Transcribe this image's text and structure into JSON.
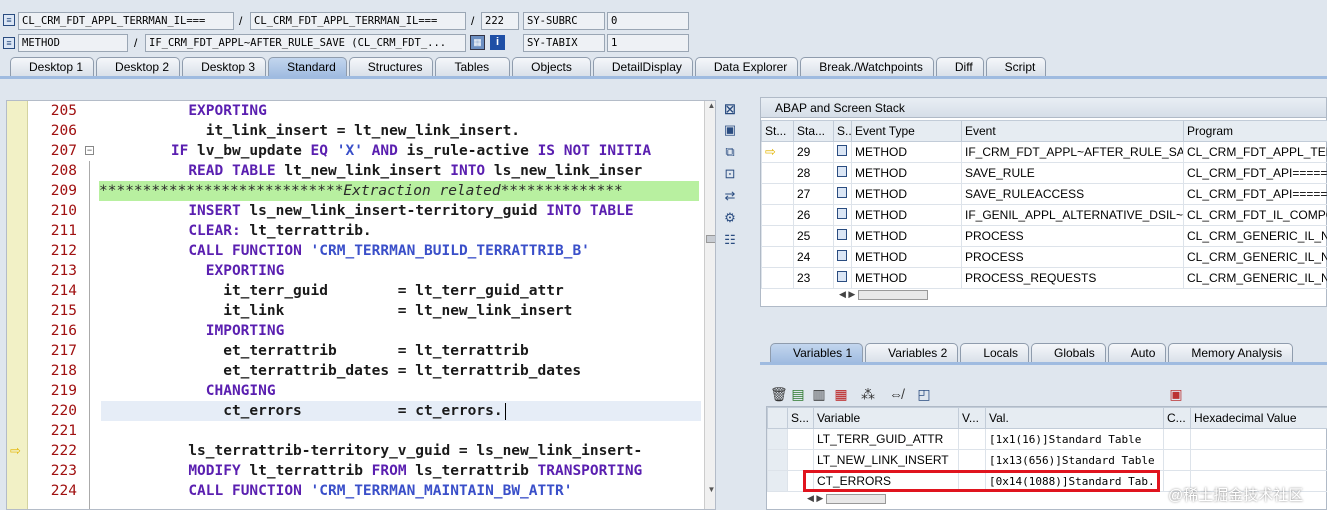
{
  "header": {
    "class_field1": "CL_CRM_FDT_APPL_TERRMAN_IL===",
    "sep1": "/",
    "class_field2": "CL_CRM_FDT_APPL_TERRMAN_IL===",
    "sep2": "/",
    "line_no": "222",
    "subrc_label": "SY-SUBRC",
    "subrc_value": "0",
    "type_field": "METHOD",
    "sep3": "/",
    "method_field": "IF_CRM_FDT_APPL~AFTER_RULE_SAVE (CL_CRM_FDT_...",
    "tabix_label": "SY-TABIX",
    "tabix_value": "1"
  },
  "tabs": [
    "Desktop 1",
    "Desktop 2",
    "Desktop 3",
    "Standard",
    "Structures",
    "Tables",
    "Objects",
    "DetailDisplay",
    "Data Explorer",
    "Break./Watchpoints",
    "Diff",
    "Script"
  ],
  "editor": {
    "lines": [
      {
        "n": "205",
        "html": "          <span class='kw'>EXPORTING</span>"
      },
      {
        "n": "206",
        "html": "            it_link_insert = lt_new_link_insert."
      },
      {
        "n": "207",
        "html": "        <span class='kw'>IF</span> lv_bw_update <span class='kw'>EQ</span> <span class='str'>'X'</span> <span class='kw'>AND</span> is_rule-active <span class='kw'>IS NOT INITIA</span>"
      },
      {
        "n": "208",
        "html": "          <span class='kw'>READ TABLE</span> lt_new_link_insert <span class='kw'>INTO</span> ls_new_link_inser"
      },
      {
        "n": "209",
        "html": "<span class='cmt'>****************************Extraction related**************</span>"
      },
      {
        "n": "210",
        "html": "          <span class='kw'>INSERT</span> ls_new_link_insert-territory_guid <span class='kw'>INTO TABLE</span>"
      },
      {
        "n": "211",
        "html": "          <span class='kw'>CLEAR:</span> lt_terrattrib."
      },
      {
        "n": "212",
        "html": "          <span class='kw'>CALL FUNCTION</span> <span class='str'>'CRM_TERRMAN_BUILD_TERRATTRIB_B'</span>"
      },
      {
        "n": "213",
        "html": "            <span class='kw'>EXPORTING</span>"
      },
      {
        "n": "214",
        "html": "              it_terr_guid        = lt_terr_guid_attr"
      },
      {
        "n": "215",
        "html": "              it_link             = lt_new_link_insert"
      },
      {
        "n": "216",
        "html": "            <span class='kw'>IMPORTING</span>"
      },
      {
        "n": "217",
        "html": "              et_terrattrib       = lt_terrattrib"
      },
      {
        "n": "218",
        "html": "              et_terrattrib_dates = lt_terrattrib_dates"
      },
      {
        "n": "219",
        "html": "            <span class='kw'>CHANGING</span>"
      },
      {
        "n": "220",
        "html": "              ct_errors           = ct_errors."
      },
      {
        "n": "221",
        "html": ""
      },
      {
        "n": "222",
        "html": "          ls_terrattrib-territory_v_guid = ls_new_link_insert-"
      },
      {
        "n": "223",
        "html": "          <span class='kw'>MODIFY</span> lt_terrattrib <span class='kw'>FROM</span> ls_terrattrib <span class='kw'>TRANSPORTING</span>"
      },
      {
        "n": "224",
        "html": "          <span class='kw'>CALL FUNCTION</span> <span class='str'>'CRM_TERRMAN_MAINTAIN_BW_ATTR'</span>"
      }
    ]
  },
  "stack": {
    "title": "ABAP and Screen Stack",
    "headers": [
      "St...",
      "Sta...",
      "S...",
      "Event Type",
      "Event",
      "Program"
    ],
    "rows": [
      {
        "level": "29",
        "type": "METHOD",
        "event": "IF_CRM_FDT_APPL~AFTER_RULE_SAVE",
        "program": "CL_CRM_FDT_APPL_TERR",
        "current": true
      },
      {
        "level": "28",
        "type": "METHOD",
        "event": "SAVE_RULE",
        "program": "CL_CRM_FDT_API=====",
        "current": false
      },
      {
        "level": "27",
        "type": "METHOD",
        "event": "SAVE_RULEACCESS",
        "program": "CL_CRM_FDT_API=====",
        "current": false
      },
      {
        "level": "26",
        "type": "METHOD",
        "event": "IF_GENIL_APPL_ALTERNATIVE_DSIL~...",
        "program": "CL_CRM_FDT_IL_COMPON",
        "current": false
      },
      {
        "level": "25",
        "type": "METHOD",
        "event": "PROCESS",
        "program": "CL_CRM_GENERIC_IL_NEW",
        "current": false
      },
      {
        "level": "24",
        "type": "METHOD",
        "event": "PROCESS",
        "program": "CL_CRM_GENERIC_IL_NEW",
        "current": false
      },
      {
        "level": "23",
        "type": "METHOD",
        "event": "PROCESS_REQUESTS",
        "program": "CL_CRM_GENERIC_IL_NEW",
        "current": false
      }
    ]
  },
  "var_tabs": [
    "Variables 1",
    "Variables 2",
    "Locals",
    "Globals",
    "Auto",
    "Memory Analysis"
  ],
  "vars": {
    "headers": [
      "S...",
      "Variable",
      "V...",
      "Val.",
      "C...",
      "Hexadecimal Value"
    ],
    "rows": [
      {
        "name": "LT_TERR_GUID_ATTR",
        "value": "[1x1(16)]Standard Table"
      },
      {
        "name": "LT_NEW_LINK_INSERT",
        "value": "[1x13(656)]Standard Table"
      },
      {
        "name": "CT_ERRORS",
        "value": "[0x14(1088)]Standard Tab."
      }
    ]
  },
  "watermark": "@稀土掘金技术社区",
  "colors": {
    "highlight": "#e0141e",
    "comment_bg": "#b8f0a0",
    "current_line_bg": "#e6edf7",
    "tab_active": "#9fbbe0"
  }
}
